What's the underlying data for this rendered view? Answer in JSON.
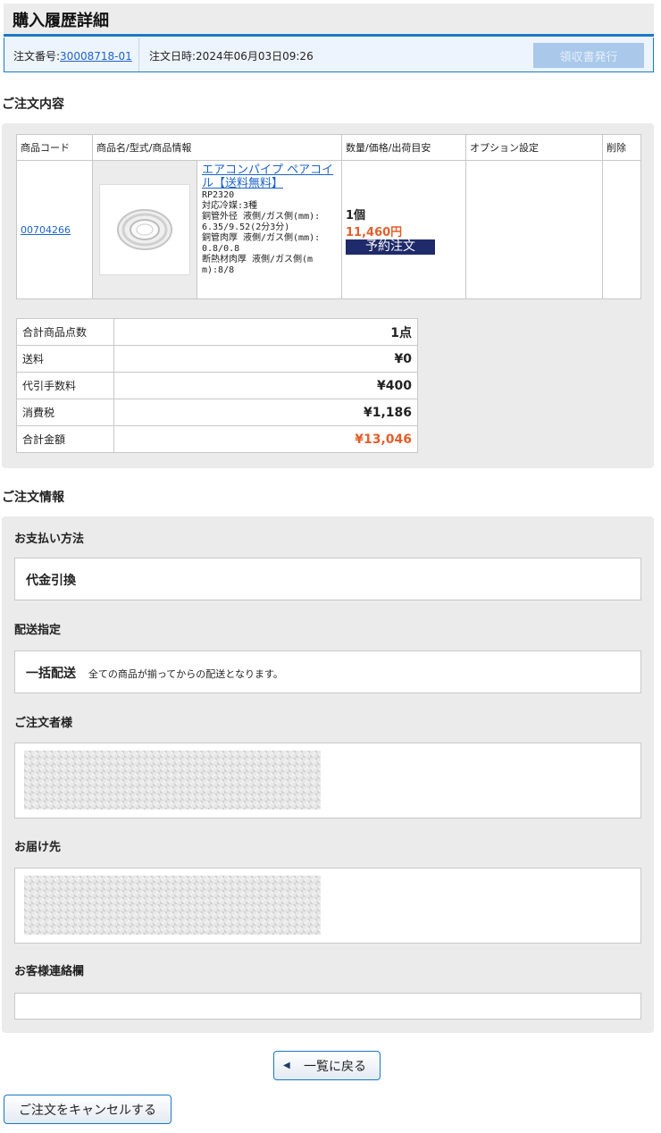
{
  "header": {
    "title": "購入履歴詳細",
    "order_no_label": "注文番号:",
    "order_no": "30008718-01",
    "order_date": "注文日時:2024年06月03日09:26",
    "receipt_button": "領収書発行"
  },
  "items_section": {
    "title": "ご注文内容",
    "columns": [
      "商品コード",
      "商品名/型式/商品情報",
      "数量/価格/出荷目安",
      "オプション設定",
      "削除"
    ],
    "item": {
      "code": "00704266",
      "name": "エアコンパイプ ペアコイル【送料無料】",
      "model": "RP2320",
      "info": [
        "対応冷媒:3種",
        "銅管外径 液側/ガス側(mm):",
        "6.35/9.52(2分3分)",
        "銅管肉厚 液側/ガス側(mm):",
        "0.8/0.8",
        "断熱材肉厚 液側/ガス側(m",
        "m):8/8"
      ],
      "image_icon": "coil-pipe-image",
      "qty": "1個",
      "price": "11,460円",
      "status": "予約注文"
    },
    "totals": [
      {
        "label": "合計商品点数",
        "value": "1点"
      },
      {
        "label": "送料",
        "value": "¥0"
      },
      {
        "label": "代引手数料",
        "value": "¥400"
      },
      {
        "label": "消費税",
        "value": "¥1,186"
      },
      {
        "label": "合計金額",
        "value": "¥13,046"
      }
    ]
  },
  "info_section": {
    "title": "ご注文情報",
    "payment_label": "お支払い方法",
    "payment_value": "代金引換",
    "delivery_label": "配送指定",
    "delivery_value": "一括配送",
    "delivery_note": "全ての商品が揃ってからの配送となります。",
    "orderer_label": "ご注文者様",
    "shipto_label": "お届け先",
    "contact_label": "お客様連絡欄"
  },
  "buttons": {
    "back": "一覧に戻る",
    "cancel": "ご注文をキャンセルする"
  },
  "colors": {
    "accent": "#1b77c7",
    "price": "#e25f2c",
    "badge": "#1e2a6a"
  }
}
